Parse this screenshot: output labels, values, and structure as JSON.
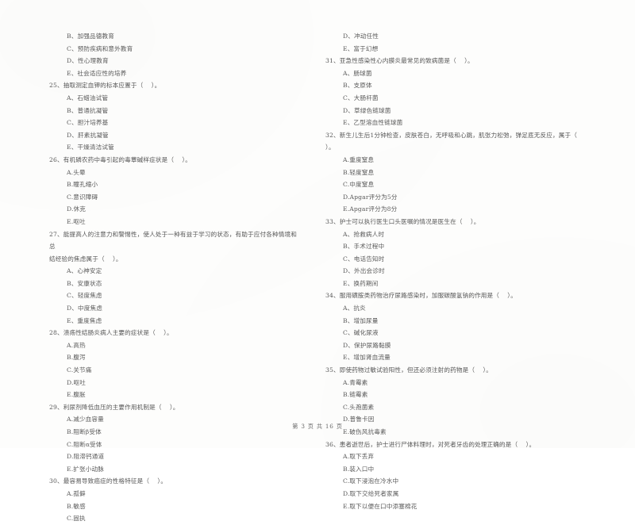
{
  "document": {
    "type": "scanned-exam-paper",
    "footer": "第 3 页 共 16 页",
    "page_number": "3",
    "total_pages": "16"
  },
  "left_column": {
    "trailing_options": [
      "B、加强品德教育",
      "C、预防疾病和意外教育",
      "D、性心理教育",
      "E、社会适应性的培养"
    ],
    "questions": [
      {
        "stem": "25、抽取测定血钾的标本应置于（    ）。",
        "options": [
          "A、石蜡油试管",
          "B、普通抗凝管",
          "C、胆汁培养基",
          "D、肝素抗凝管",
          "E、干燥清洁试管"
        ]
      },
      {
        "stem": "26、有机磷农药中毒引起的毒蕈碱样症状是（    ）。",
        "options": [
          "A.头晕",
          "B.瞳孔缩小",
          "C.意识障碍",
          "D.休克",
          "E.呕吐"
        ]
      },
      {
        "stem": "27、能提高人的注意力和警惕性，使人处于一种有益于学习的状态，有助于应付各种情境和总\n结经验的焦虑属于（    ）。",
        "options": [
          "A、心神安定",
          "B、安康状态",
          "C、轻度焦虑",
          "D、中度焦虑",
          "E、重度焦虑"
        ]
      },
      {
        "stem": "28、溃疡性结肠炎病人主要的症状是（    ）。",
        "options": [
          "A.高热",
          "B.腹泻",
          "C.关节痛",
          "D.呕吐",
          "E.腹胀"
        ]
      },
      {
        "stem": "29、利尿剂降低血压的主要作用机制是（    ）。",
        "options": [
          "A.减少血容量",
          "B.阻断β受体",
          "C.阻断α受体",
          "D.阻滞钙通道",
          "E.扩张小动脉"
        ]
      },
      {
        "stem": "30、最容易导致癌症的性格特征是（    ）。",
        "options": [
          "A.孤僻",
          "B.敏感",
          "C.固执"
        ]
      }
    ]
  },
  "right_column": {
    "trailing_options": [
      "D、冲动任性",
      "E、富于幻想"
    ],
    "questions": [
      {
        "stem": "31、亚急性感染性心内膜炎最常见的致病菌是（    ）。",
        "options": [
          "A、肠球菌",
          "B、支原体",
          "C、大肠杆菌",
          "D、草绿色链球菌",
          "E、乙型溶血性链球菌"
        ]
      },
      {
        "stem": "32、新生儿生后1分钟检查，皮肤苍白，无呼吸和心跳，肌张力松弛，弹足底无反应，属于（\n）。",
        "options": [
          "A.重度窒息",
          "B.轻度窒息",
          "C.中度窒息",
          "D.Apgar评分为5分",
          "E.Apgar评分为8分"
        ]
      },
      {
        "stem": "33、护士可以执行医生口头医嘱的情况是医生在（    ）。",
        "options": [
          "A、抢救病人时",
          "B、手术过程中",
          "C、电话告知时",
          "D、外出会诊时",
          "E、换药期间"
        ]
      },
      {
        "stem": "34、服用磺胺类药物治疗尿路感染时，加服碳酸氢钠的作用是（    ）。",
        "options": [
          "A、抗炎",
          "B、增加尿量",
          "C、碱化尿液",
          "D、保护尿路黏膜",
          "E、增加肾血流量"
        ]
      },
      {
        "stem": "35、即使药物过敏试验阳性，但还必须注射的药物是（    ）。",
        "options": [
          "A.青霉素",
          "B.链霉素",
          "C.头孢菌素",
          "D.普鲁卡因",
          "E.破伤风抗毒素"
        ]
      },
      {
        "stem": "36、患者逝世后，护士进行尸体料理时，对死者牙齿的处理正确的是（    ）。",
        "options": [
          "A.取下丢弃",
          "B.装入口中",
          "C.取下浸泡在冷水中",
          "D.取下交给死者家属",
          "E.取下以便在口中添塞棉花"
        ]
      }
    ]
  }
}
